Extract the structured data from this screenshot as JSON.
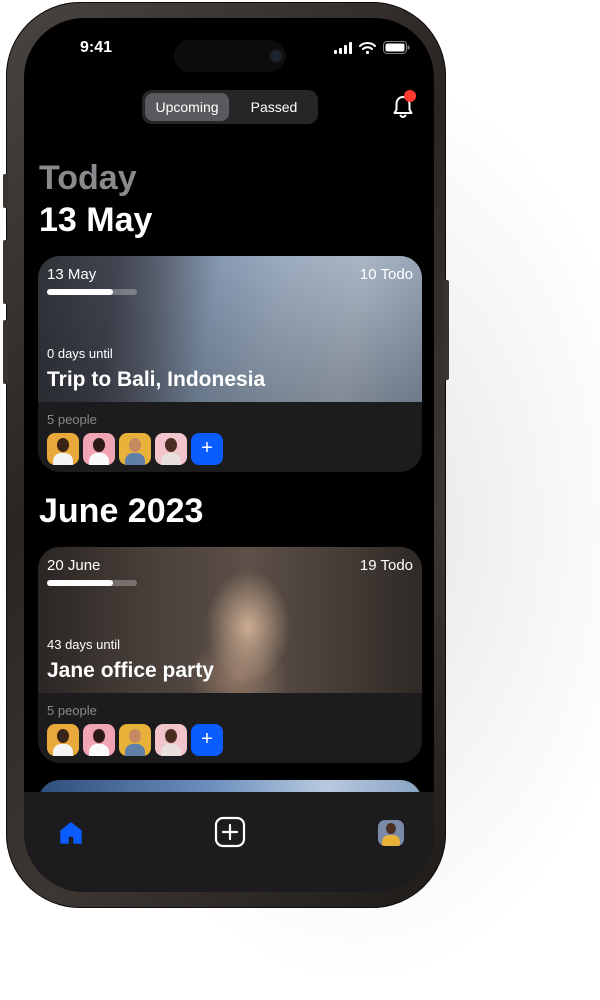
{
  "status_bar": {
    "time": "9:41"
  },
  "segmented": {
    "upcoming": "Upcoming",
    "passed": "Passed"
  },
  "headings": {
    "today": "Today",
    "today_date": "13 May",
    "month": "June 2023"
  },
  "trips": [
    {
      "date": "13 May",
      "todo": "10 Todo",
      "progress": 0.73,
      "days_until": "0 days until",
      "title": "Trip to Bali, Indonesia",
      "people": "5 people"
    },
    {
      "date": "20 June",
      "todo": "19 Todo",
      "progress": 0.73,
      "days_until": "43 days until",
      "title": "Jane office party",
      "people": "5 people"
    }
  ],
  "add_person_label": "+",
  "colors": {
    "accent": "#0a5cff",
    "notification": "#ff3b30",
    "card": "#1c1c1e",
    "muted": "#8a8a8e"
  }
}
